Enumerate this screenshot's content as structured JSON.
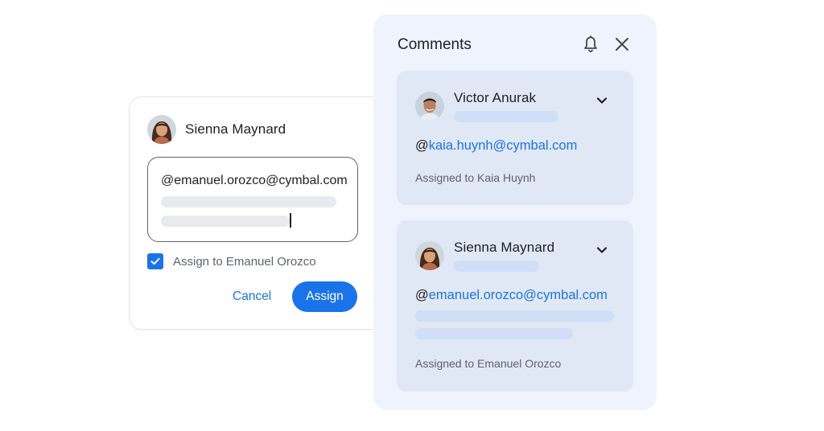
{
  "compose": {
    "author": "Sienna Maynard",
    "input_value": "@emanuel.orozco@cymbal.com",
    "checkbox_label": "Assign to Emanuel Orozco",
    "checkbox_checked": true,
    "cancel_label": "Cancel",
    "assign_label": "Assign"
  },
  "panel": {
    "title": "Comments",
    "icons": [
      "bell-icon",
      "close-icon"
    ],
    "comments": [
      {
        "author": "Victor Anurak",
        "mention_prefix": "@",
        "mention_email": "kaia.huynh@cymbal.com",
        "assigned_text": "Assigned to Kaia Huynh"
      },
      {
        "author": "Sienna Maynard",
        "mention_prefix": "@",
        "mention_email": "emanuel.orozco@cymbal.com",
        "assigned_text": "Assigned to Emanuel Orozco"
      }
    ]
  },
  "colors": {
    "accent": "#1a73e8",
    "panel_bg": "#eef3fd",
    "card_bg": "#e1e8f5",
    "skeleton": "#d0def7"
  }
}
